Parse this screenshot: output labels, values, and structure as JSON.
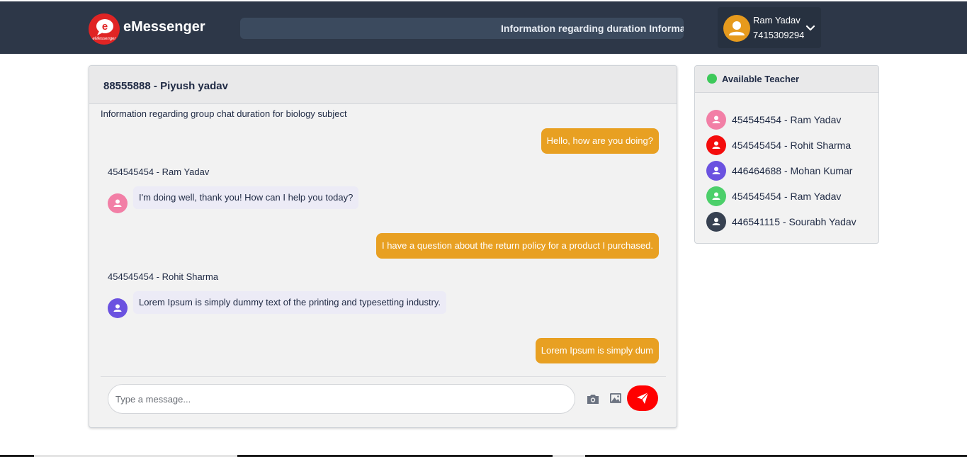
{
  "header": {
    "brand": "eMessenger",
    "logo_text": "eMessenger",
    "ticker": "Information regarding duration Information regarding duration",
    "user": {
      "name": "Ram Yadav",
      "phone": "7415309294"
    }
  },
  "chat": {
    "title": "88555888 - Piyush yadav",
    "subject": "Information regarding group chat duration for biology subject",
    "messages": [
      {
        "type": "out",
        "text": "Hello, how are you doing?"
      },
      {
        "type": "in",
        "sender": "454545454 - Ram Yadav",
        "text": "I'm doing well, thank you! How can I help you today?",
        "avatar_color": "#f27fa6"
      },
      {
        "type": "out",
        "text": "I have a question about the return policy for a product I purchased."
      },
      {
        "type": "in",
        "sender": "454545454 - Rohit Sharma",
        "text": "Lorem Ipsum is simply dummy text of the printing and typesetting industry.",
        "avatar_color": "#6b52e0"
      },
      {
        "type": "out",
        "text": "Lorem Ipsum is simply dum"
      }
    ],
    "input_placeholder": "Type a message...",
    "input_value": ""
  },
  "teachers": {
    "title": "Available Teacher",
    "status_color": "#3dc95a",
    "items": [
      {
        "label": "454545454 - Ram Yadav",
        "color": "#f27fa6"
      },
      {
        "label": "454545454 - Rohit Sharma",
        "color": "#f40c0c"
      },
      {
        "label": "446464688 - Mohan Kumar",
        "color": "#6b52e0"
      },
      {
        "label": "454545454 - Ram Yadav",
        "color": "#4ccf6a"
      },
      {
        "label": "446541115 - Sourabh Yadav",
        "color": "#374151"
      }
    ]
  },
  "colors": {
    "topbar": "#2d3748",
    "outgoing_bubble": "#e8a022",
    "send_button": "#ff0000",
    "user_avatar": "#e69a1d"
  }
}
